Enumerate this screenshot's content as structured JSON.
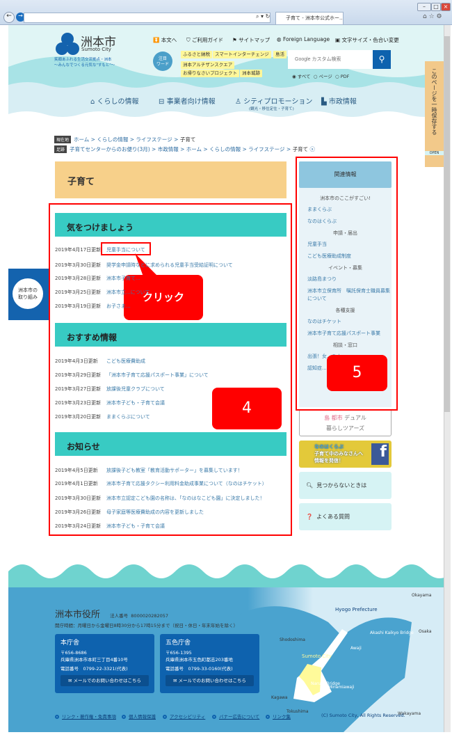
{
  "browser": {
    "tab_title": "子育て - 洲本市公式ホー...",
    "address": ""
  },
  "header": {
    "logo_text": "洲本市",
    "logo_sub": "Sumoto City",
    "tagline1": "笑顔あふれる生活交流拠点・洲本",
    "tagline2": "～みんなでつくる元気な\"すもと\"～",
    "utility": [
      {
        "icon": "skip-icon",
        "label": "本文へ"
      },
      {
        "icon": "guide-icon",
        "label": "ご利用ガイド"
      },
      {
        "icon": "sitemap-icon",
        "label": "サイトマップ"
      },
      {
        "icon": "globe-icon",
        "label": "Foreign Language"
      },
      {
        "icon": "font-size-icon",
        "label": "文字サイズ・色合い変更"
      }
    ],
    "keyword_badge": "注目\nワード",
    "keywords": [
      "ふるさと納税",
      "スマートインターチェンジ",
      "島活",
      "洲本アルチザンスクエア",
      "お帰りなさいプロジェクト",
      "洲本城跡"
    ],
    "search": {
      "placeholder": "Google カスタム検索",
      "options": [
        "すべて",
        "ページ",
        "PDF"
      ],
      "selected": "すべて"
    }
  },
  "nav": [
    {
      "icon": "house-icon",
      "label": "くらしの情報"
    },
    {
      "icon": "briefcase-icon",
      "label": "事業者向け情報"
    },
    {
      "icon": "person-icon",
      "label": "シティプロモーション",
      "sub": "(観光・移住定住・子育て)"
    },
    {
      "icon": "building-icon",
      "label": "市政情報"
    }
  ],
  "breadcrumb": {
    "current_label": "現在地",
    "current": [
      "ホーム",
      "くらしの情報",
      "ライフステージ",
      "子育て"
    ],
    "history_label": "足跡",
    "history": [
      "子育てセンターからのお便り(3月)",
      "市政情報",
      "ホーム",
      "くらしの情報",
      "ライフステージ",
      "子育て"
    ]
  },
  "page_title": "子育て",
  "sections": [
    {
      "title": "気をつけましょう",
      "items": [
        {
          "date": "2019年4月17日更新",
          "title": "児童手当について"
        },
        {
          "date": "2019年3月30日更新",
          "title": "奨学金申請時などに求められる児童手当受給証明について"
        },
        {
          "date": "2019年3月28日更新",
          "title": "洲本市子育て..."
        },
        {
          "date": "2019年3月25日更新",
          "title": "洲本市立...について"
        },
        {
          "date": "2019年3月19日更新",
          "title": "お子さま..."
        }
      ]
    },
    {
      "title": "おすすめ情報",
      "items": [
        {
          "date": "2019年4月3日更新",
          "title": "こども医療費助成"
        },
        {
          "date": "2019年3月29日更新",
          "title": "「洲本市子育て応援パスポート事業」について"
        },
        {
          "date": "2019年3月27日更新",
          "title": "放課後児童クラブについて"
        },
        {
          "date": "2019年3月23日更新",
          "title": "洲本市子ども・子育て会議"
        },
        {
          "date": "2019年3月20日更新",
          "title": "ままくらぶについて"
        }
      ]
    },
    {
      "title": "お知らせ",
      "items": [
        {
          "date": "2019年4月5日更新",
          "title": "放課後子ども教室「教育活動サポーター」を募集しています！"
        },
        {
          "date": "2019年4月1日更新",
          "title": "洲本市子育て応援タクシー利用料金助成事業について（なのはチケット）"
        },
        {
          "date": "2019年3月30日更新",
          "title": "洲本市立認定こども園の名称は、「なのはなこども園」に決定しました！"
        },
        {
          "date": "2019年3月26日更新",
          "title": "母子家庭等医療費助成の内容を更新しました"
        },
        {
          "date": "2019年3月24日更新",
          "title": "洲本市子ども・子育て会議"
        }
      ]
    }
  ],
  "sidebar": {
    "title": "関連情報",
    "groups": [
      {
        "category": "洲本市のここがすごい!",
        "links": [
          "ままくらぶ",
          "なのはくらぶ"
        ]
      },
      {
        "category": "申請・届出",
        "links": [
          "児童手当",
          "こども医療助成制度"
        ]
      },
      {
        "category": "イベント・募集",
        "links": [
          "淡路島まつり",
          "洲本市立保育所　嘱託保育士職員募集について"
        ]
      },
      {
        "category": "各種支援",
        "links": [
          "なのはチケット",
          "洲本市子育て応援パスポート事業"
        ]
      },
      {
        "category": "相談・窓口",
        "links": [
          "出張！女...ミナー",
          "認知症...のご相談"
        ]
      }
    ]
  },
  "banners": {
    "tour": "島 都市 デュアル 暮らしツアーズ",
    "nanoha": "なのはくらぶ 子育て中のみなさんへ情報を発信！",
    "not_found": "見つからないときは",
    "faq": "よくある質問"
  },
  "left_tab": "洲本市の\n取り組み",
  "right_tab": {
    "label": "このページを一時保存する",
    "open": "OPEN"
  },
  "annotations": {
    "click": "クリック",
    "box4": "4",
    "box5": "5",
    "color": "#ff0000"
  },
  "footer": {
    "title": "洲本市役所",
    "corp_label": "法人番号",
    "corp_no": "8000020282057",
    "hours": "開庁時間：月曜日から金曜日8時30分から17時15分まで（祝日・休日・年末年始を除く）",
    "offices": [
      {
        "name": "本庁舎",
        "zip": "〒656-8686",
        "addr": "兵庫県洲本市本町三丁目4番10号",
        "tel": "電話番号　0799-22-3321(代表)",
        "mail": "メールでのお問い合わせはこちら"
      },
      {
        "name": "五色庁舎",
        "zip": "〒656-1395",
        "addr": "兵庫県洲本市五色町都志203番地",
        "tel": "電話番号　0799-33-0160(代表)",
        "mail": "メールでのお問い合わせはこちら"
      }
    ],
    "links": [
      "リンク・著作権・免責事項",
      "個人情報保護",
      "アクセシビリティ",
      "バナー広告について",
      "リンク集"
    ],
    "copyright": "(C) Sumoto City, All Rights Reserved.",
    "map_labels": [
      "Hyogo Prefecture",
      "Okayama",
      "Shodoshima",
      "Akashi Kaikyo Bridge",
      "Osaka",
      "Awaji",
      "Sumoto City",
      "Naruto Bridge",
      "Minamiawaji",
      "Kagawa",
      "Tokushima",
      "Wakayama"
    ]
  },
  "colors": {
    "teal": "#38cbc3",
    "title_bg": "#f7d08a",
    "link": "#3a7aa8",
    "footer_blue": "#0e62ae",
    "sidebar_head": "#8ec6df"
  }
}
